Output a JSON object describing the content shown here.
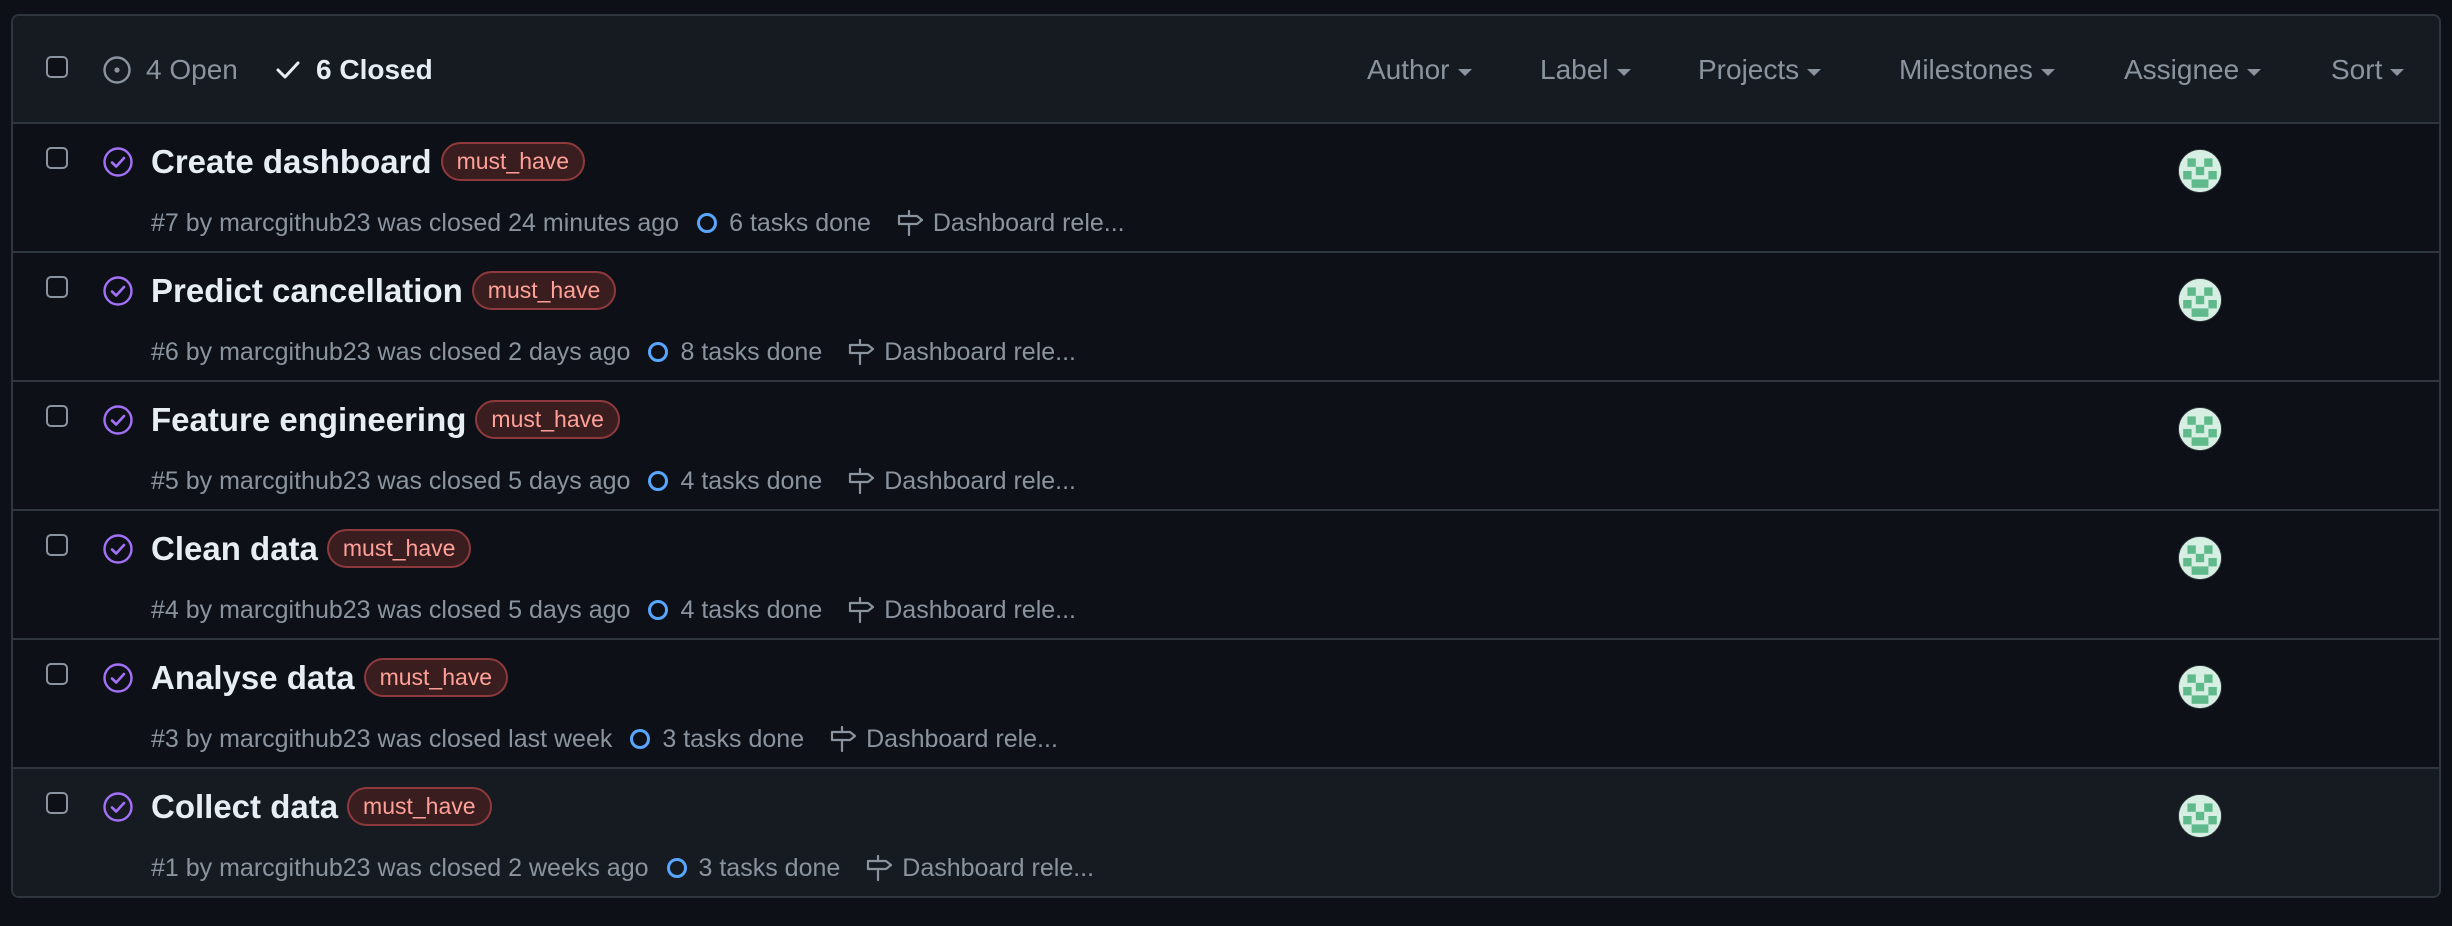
{
  "header": {
    "open_label": "4 Open",
    "closed_label": "6 Closed",
    "filters": [
      "Author",
      "Label",
      "Projects",
      "Milestones",
      "Assignee",
      "Sort"
    ]
  },
  "colors": {
    "background": "#0d1117",
    "header_bg": "#161b22",
    "border": "#30363d",
    "closed_icon": "#a371f7",
    "task_icon": "#58a6ff",
    "label_text": "#ffa198"
  },
  "issues": [
    {
      "title": "Create dashboard",
      "label": "must_have",
      "meta": "#7 by marcgithub23 was closed 24 minutes ago",
      "tasks": "6 tasks done",
      "milestone": "Dashboard rele...",
      "state_icon": "closed-check-circle-icon"
    },
    {
      "title": "Predict cancellation",
      "label": "must_have",
      "meta": "#6 by marcgithub23 was closed 2 days ago",
      "tasks": "8 tasks done",
      "milestone": "Dashboard rele...",
      "state_icon": "closed-check-circle-icon"
    },
    {
      "title": "Feature engineering",
      "label": "must_have",
      "meta": "#5 by marcgithub23 was closed 5 days ago",
      "tasks": "4 tasks done",
      "milestone": "Dashboard rele...",
      "state_icon": "closed-check-circle-icon"
    },
    {
      "title": "Clean data",
      "label": "must_have",
      "meta": "#4 by marcgithub23 was closed 5 days ago",
      "tasks": "4 tasks done",
      "milestone": "Dashboard rele...",
      "state_icon": "closed-check-circle-icon"
    },
    {
      "title": "Analyse data",
      "label": "must_have",
      "meta": "#3 by marcgithub23 was closed last week",
      "tasks": "3 tasks done",
      "milestone": "Dashboard rele...",
      "state_icon": "closed-check-circle-icon"
    },
    {
      "title": "Collect data",
      "label": "must_have",
      "meta": "#1 by marcgithub23 was closed 2 weeks ago",
      "tasks": "3 tasks done",
      "milestone": "Dashboard rele...",
      "state_icon": "closed-check-circle-icon"
    }
  ]
}
